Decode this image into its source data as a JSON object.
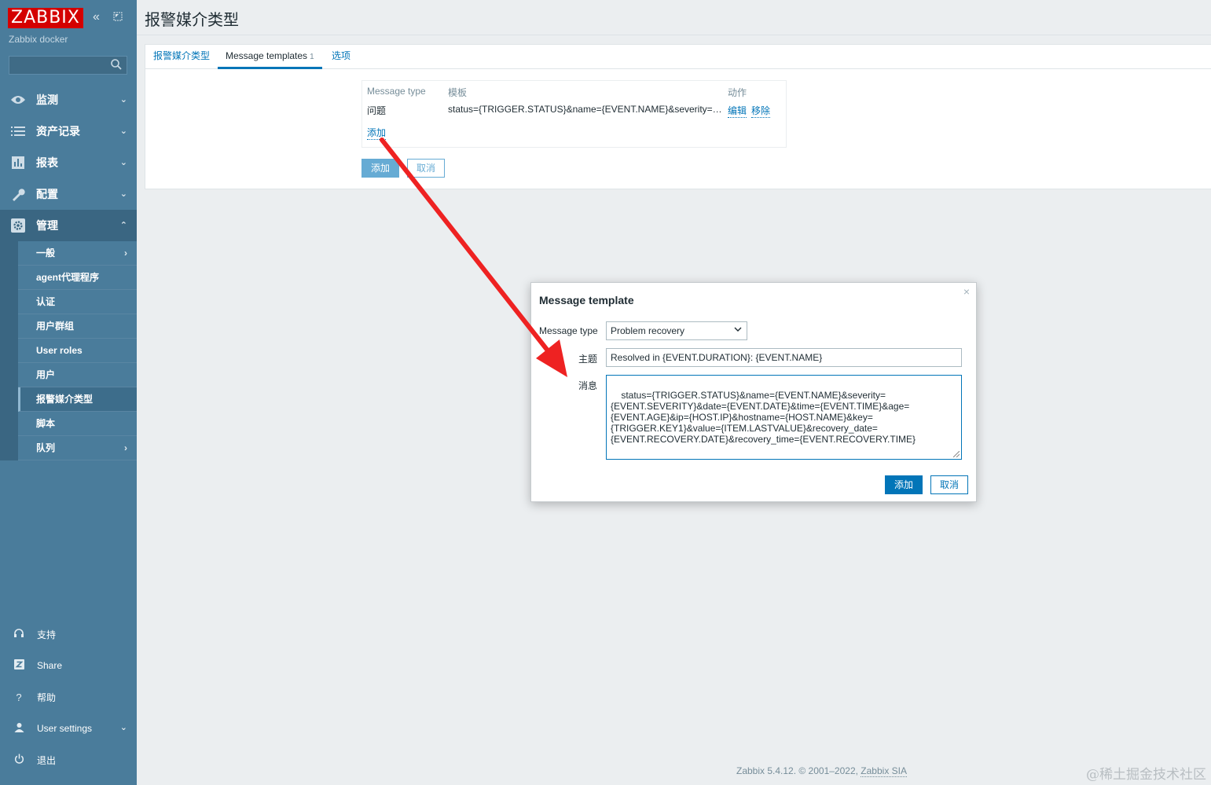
{
  "sidebar": {
    "logo": "ZABBIX",
    "server_name": "Zabbix docker",
    "search_placeholder": "",
    "menu": [
      {
        "label": "监测",
        "icon": "eye-icon"
      },
      {
        "label": "资产记录",
        "icon": "list-icon"
      },
      {
        "label": "报表",
        "icon": "bar-chart-icon"
      },
      {
        "label": "配置",
        "icon": "wrench-icon"
      },
      {
        "label": "管理",
        "icon": "gear-icon"
      }
    ],
    "admin_submenu": [
      "一般",
      "agent代理程序",
      "认证",
      "用户群组",
      "User roles",
      "用户",
      "报警媒介类型",
      "脚本",
      "队列"
    ],
    "bottom": [
      {
        "label": "支持",
        "icon": "headset-icon"
      },
      {
        "label": "Share",
        "icon": "share-z-icon"
      },
      {
        "label": "帮助",
        "icon": "question-icon"
      },
      {
        "label": "User settings",
        "icon": "user-icon"
      },
      {
        "label": "退出",
        "icon": "power-icon"
      }
    ]
  },
  "page": {
    "title": "报警媒介类型",
    "tabs": [
      {
        "label": "报警媒介类型"
      },
      {
        "label": "Message templates",
        "count": "1"
      },
      {
        "label": "选项"
      }
    ],
    "templates_table": {
      "headers": [
        "Message type",
        "模板",
        "动作"
      ],
      "rows": [
        {
          "type": "问题",
          "template": "status={TRIGGER.STATUS}&name={EVENT.NAME}&severity=…",
          "edit": "编辑",
          "remove": "移除"
        }
      ],
      "add_link": "添加"
    },
    "add_button": "添加",
    "cancel_button": "取消"
  },
  "modal": {
    "title": "Message template",
    "message_type_label": "Message type",
    "message_type_value": "Problem recovery",
    "subject_label": "主题",
    "subject_value": "Resolved in {EVENT.DURATION}: {EVENT.NAME}",
    "message_label": "消息",
    "message_value": "status={TRIGGER.STATUS}&name={EVENT.NAME}&severity=\n{EVENT.SEVERITY}&date={EVENT.DATE}&time={EVENT.TIME}&age=\n{EVENT.AGE}&ip={HOST.IP}&hostname={HOST.NAME}&key=\n{TRIGGER.KEY1}&value={ITEM.LASTVALUE}&recovery_date=\n{EVENT.RECOVERY.DATE}&recovery_time={EVENT.RECOVERY.TIME}",
    "add_button": "添加",
    "cancel_button": "取消"
  },
  "footer": {
    "text": "Zabbix 5.4.12. © 2001–2022, ",
    "link": "Zabbix SIA"
  },
  "watermark": "@稀土掘金技术社区",
  "colors": {
    "sidebar": "#4a7c9b",
    "accent": "#0275b8",
    "logo": "#d40000",
    "annotation_arrow": "#ee2222"
  }
}
